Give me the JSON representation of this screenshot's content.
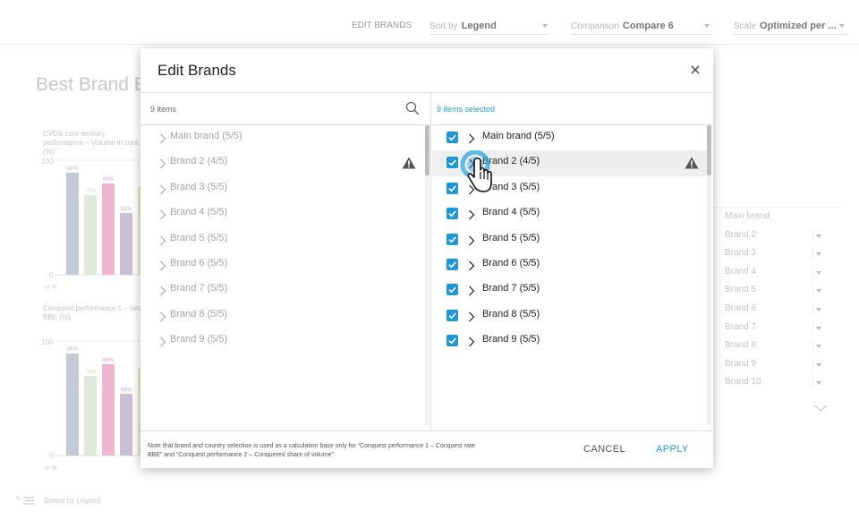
{
  "toolbar": {
    "edit_brands": "EDIT BRANDS",
    "sort_label": "Sort by",
    "sort_value": "Legend",
    "comparison_label": "Comparison",
    "comparison_value": "Compare 6",
    "scale_label": "Scale",
    "scale_value": "Optimized per ..."
  },
  "background": {
    "page_title": "Best Brand E",
    "chart1_title": "CVDS core territory performance – Volume in core (%)",
    "chart2_title": "Conquest performance 1 – rate BBE (%)",
    "axis_top": "100",
    "axis_bottom": "0",
    "unit": "in %",
    "bar_labels": [
      "88%",
      "78%",
      "84%",
      "68%"
    ],
    "legend": [
      "Main brand",
      "Brand 2",
      "Brand 3",
      "Brand 4",
      "Brand 5",
      "Brand 6",
      "Brand 7",
      "Brand 8",
      "Brand 9",
      "Brand 10"
    ],
    "sorted_text": "Sorted by Legend"
  },
  "modal": {
    "title": "Edit Brands",
    "left_count": "9 items",
    "right_count": "9 items selected",
    "left_items": [
      "Main brand (5/5)",
      "Brand 2 (4/5)",
      "Brand 3 (5/5)",
      "Brand 4 (5/5)",
      "Brand 5 (5/5)",
      "Brand 6 (5/5)",
      "Brand 7 (5/5)",
      "Brand 8 (5/5)",
      "Brand 9 (5/5)"
    ],
    "right_items": [
      "Main brand (5/5)",
      "Brand 2 (4/5)",
      "Brand 3 (5/5)",
      "Brand 4 (5/5)",
      "Brand 5 (5/5)",
      "Brand 6 (5/5)",
      "Brand 7 (5/5)",
      "Brand 8 (5/5)",
      "Brand 9 (5/5)"
    ],
    "note": "Note that brand and country selection is used as a calculation base only for “Conquest performance 1 – Conquest rate BBE” and “Conquest performance 2 – Conquered share of volume”",
    "cancel": "CANCEL",
    "apply": "APPLY"
  },
  "colors": {
    "accent": "#1e98d4",
    "bar_colors": [
      "#9aaac0",
      "#c7dcc3",
      "#e787b0",
      "#a592b8",
      "#d9e2a4"
    ]
  }
}
